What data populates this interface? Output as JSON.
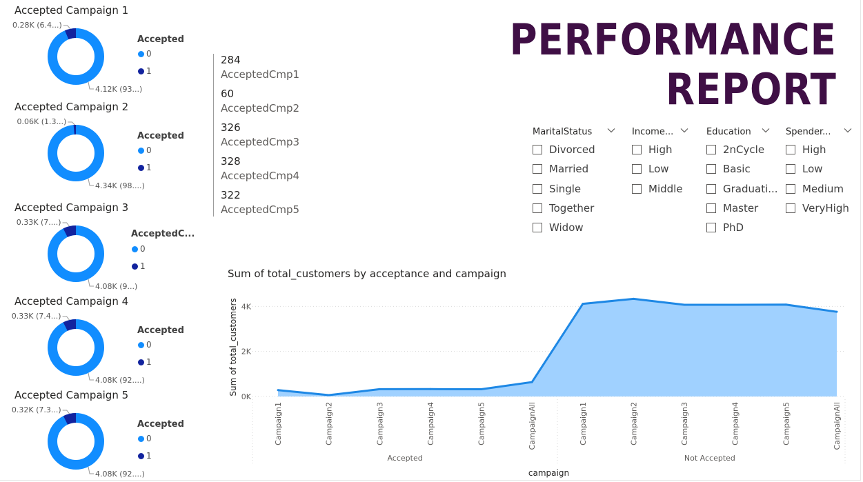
{
  "header": {
    "title_line1": "PERFORMANCE",
    "title_line2": "REPORT"
  },
  "donuts": [
    {
      "title": "Accepted Campaign 1",
      "legend_title": "Accepted",
      "legend": [
        "0",
        "1"
      ],
      "label_small": "0.28K (6.4...)",
      "label_large": "4.12K (93...)",
      "fraction_accepted": 0.064
    },
    {
      "title": "Accepted Campaign 2",
      "legend_title": "Accepted",
      "legend": [
        "0",
        "1"
      ],
      "label_small": "0.06K (1.3...)",
      "label_large": "4.34K (98....)",
      "fraction_accepted": 0.013
    },
    {
      "title": "Accepted Campaign 3",
      "legend_title": "AcceptedC...",
      "legend": [
        "0",
        "1"
      ],
      "label_small": "0.33K (7....)",
      "label_large": "4.08K (9...)",
      "fraction_accepted": 0.074
    },
    {
      "title": "Accepted Campaign 4",
      "legend_title": "Accepted",
      "legend": [
        "0",
        "1"
      ],
      "label_small": "0.33K (7.4...)",
      "label_large": "4.08K (92....)",
      "fraction_accepted": 0.074
    },
    {
      "title": "Accepted Campaign 5",
      "legend_title": "Accepted",
      "legend": [
        "0",
        "1"
      ],
      "label_small": "0.32K (7.3...)",
      "label_large": "4.08K (92....)",
      "fraction_accepted": 0.073
    }
  ],
  "kpis": [
    {
      "value": "284",
      "label": "AcceptedCmp1"
    },
    {
      "value": "60",
      "label": "AcceptedCmp2"
    },
    {
      "value": "326",
      "label": "AcceptedCmp3"
    },
    {
      "value": "328",
      "label": "AcceptedCmp4"
    },
    {
      "value": "322",
      "label": "AcceptedCmp5"
    }
  ],
  "slicers": [
    {
      "title": "MaritalStatus",
      "options": [
        "Divorced",
        "Married",
        "Single",
        "Together",
        "Widow"
      ]
    },
    {
      "title": "Income...",
      "options": [
        "High",
        "Low",
        "Middle"
      ]
    },
    {
      "title": "Education",
      "options": [
        "2nCycle",
        "Basic",
        "Graduati...",
        "Master",
        "PhD"
      ]
    },
    {
      "title": "Spender...",
      "options": [
        "High",
        "Low",
        "Medium",
        "VeryHigh"
      ]
    }
  ],
  "colors": {
    "series_0": "#118dff",
    "series_1": "#12239e",
    "area_fill": "#a0d1ff",
    "area_line": "#1e88e5",
    "title": "#3f0f45"
  },
  "icons": {
    "slicer_dropdown": "chevron-down-icon"
  },
  "chart_data": {
    "type": "area",
    "title": "Sum of total_customers by acceptance and campaign",
    "xlabel": "campaign",
    "ylabel": "Sum of total_customers",
    "ylim": [
      0,
      4500
    ],
    "yticks": [
      0,
      2000,
      4000
    ],
    "ytick_labels": [
      "0K",
      "2K",
      "4K"
    ],
    "groups": [
      {
        "name": "Accepted",
        "categories": [
          "Campaign1",
          "Campaign2",
          "Campaign3",
          "Campaign4",
          "Campaign5",
          "CampaignAll"
        ]
      },
      {
        "name": "Not Accepted",
        "categories": [
          "Campaign1",
          "Campaign2",
          "Campaign3",
          "Campaign4",
          "Campaign5",
          "CampaignAll"
        ]
      }
    ],
    "series": [
      {
        "values": [
          284,
          60,
          326,
          328,
          322,
          640,
          4112,
          4336,
          4070,
          4072,
          4078,
          3760
        ]
      }
    ],
    "grid": true
  }
}
